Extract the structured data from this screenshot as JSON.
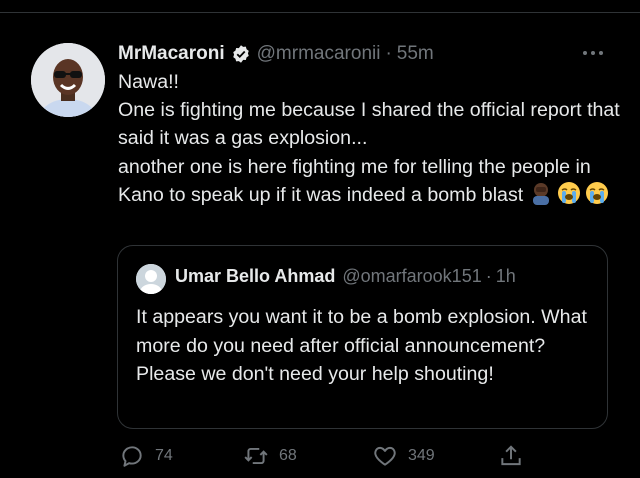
{
  "tweet": {
    "author_name": "MrMacaroni",
    "author_handle": "@mrmacaronii",
    "separator": "·",
    "time": "55m",
    "lines": [
      "Nawa!!",
      "One is fighting me because I shared the official report that said it was a gas explosion...",
      "another one is here fighting me for telling the people in Kano to speak up if it was indeed a bomb blast"
    ],
    "emojis": [
      "man-facepalming-emoji",
      "loudly-crying-face-emoji",
      "loudly-crying-face-emoji"
    ]
  },
  "quote": {
    "author_name": "Umar Bello Ahmad",
    "author_handle": "@omarfarook151",
    "separator": "·",
    "time": "1h",
    "text": "It appears you want it to be a bomb explosion. What more do you need after official announcement? Please we don't need your help shouting!"
  },
  "actions": {
    "replies": "74",
    "retweets": "68",
    "likes": "349"
  },
  "colors": {
    "background": "#000000",
    "text": "#e7e9ea",
    "muted": "#71767b",
    "border": "#2f3336"
  }
}
